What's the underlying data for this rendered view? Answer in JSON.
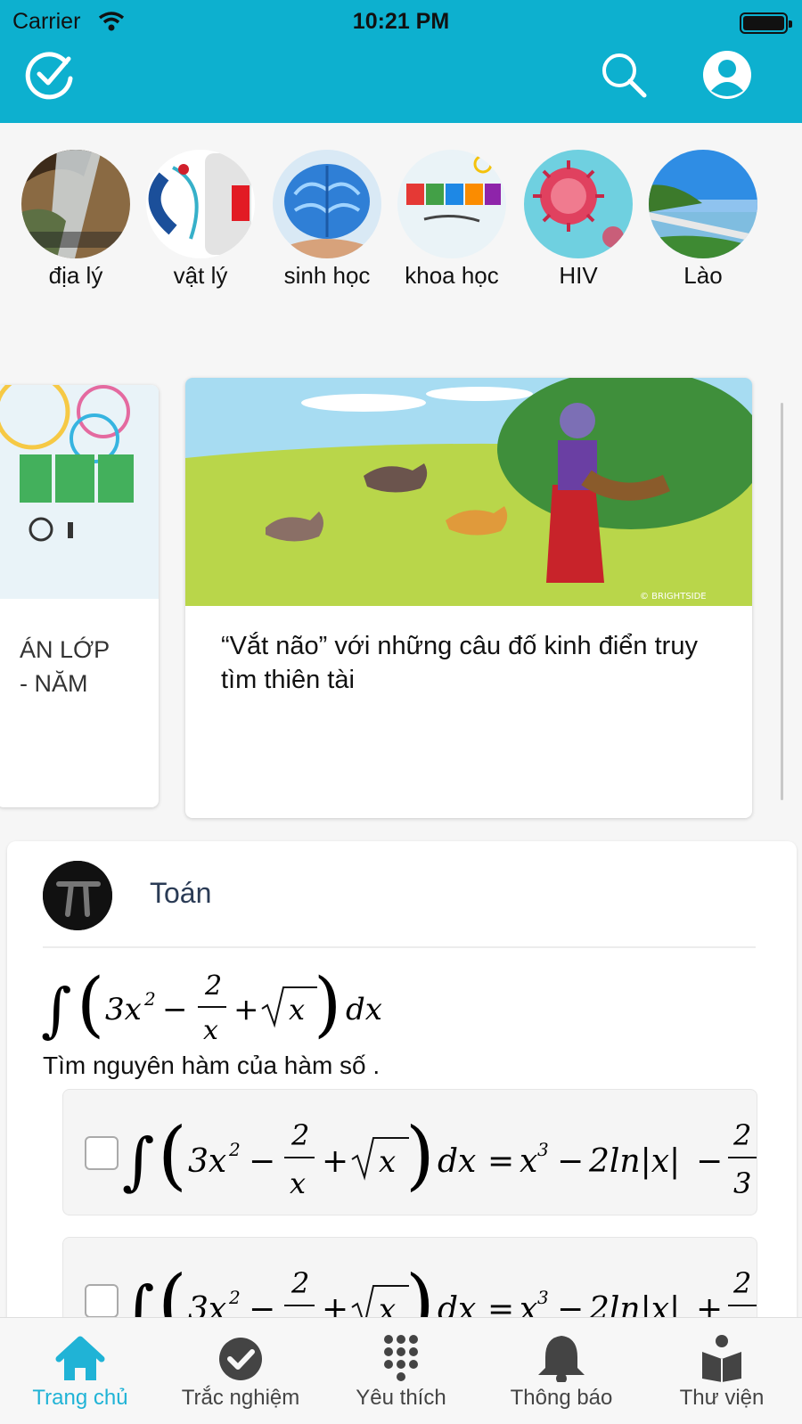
{
  "status_bar": {
    "carrier": "Carrier",
    "time": "10:21 PM"
  },
  "top_bar": {
    "left_icon": "check-circle-icon",
    "right_icons": [
      "search-icon",
      "account-icon"
    ],
    "color": "#0db0cf"
  },
  "stories": [
    {
      "label": "địa lý",
      "icon": "geography-image"
    },
    {
      "label": "vật lý",
      "icon": "physics-image"
    },
    {
      "label": "sinh học",
      "icon": "brain-image"
    },
    {
      "label": "khoa học",
      "icon": "stem-logo-image"
    },
    {
      "label": "HIV",
      "icon": "virus-image"
    },
    {
      "label": "Lào",
      "icon": "bridge-landscape-image"
    }
  ],
  "cards": {
    "left": {
      "title_line1": "ÁN LỚP",
      "title_line2": "- NĂM"
    },
    "main": {
      "title": "“Vắt não” với những câu đố kinh điển truy tìm thiên tài",
      "image_caption": "© BRIGHTSIDE"
    }
  },
  "question": {
    "subject": "Toán",
    "text": "Tìm nguyên hàm của hàm số .",
    "answers": [
      {
        "checked": false,
        "sign": "−"
      },
      {
        "checked": false,
        "sign": "+"
      }
    ]
  },
  "tabs": [
    {
      "label": "Trang chủ",
      "icon": "home-icon",
      "active": true
    },
    {
      "label": "Trắc nghiệm",
      "icon": "check-circle-icon",
      "active": false
    },
    {
      "label": "Yêu thích",
      "icon": "keypad-icon",
      "active": false
    },
    {
      "label": "Thông báo",
      "icon": "bell-icon",
      "active": false
    },
    {
      "label": "Thư viện",
      "icon": "library-icon",
      "active": false
    }
  ],
  "colors": {
    "accent": "#0db0cf",
    "active_tab": "#20b3d6"
  }
}
